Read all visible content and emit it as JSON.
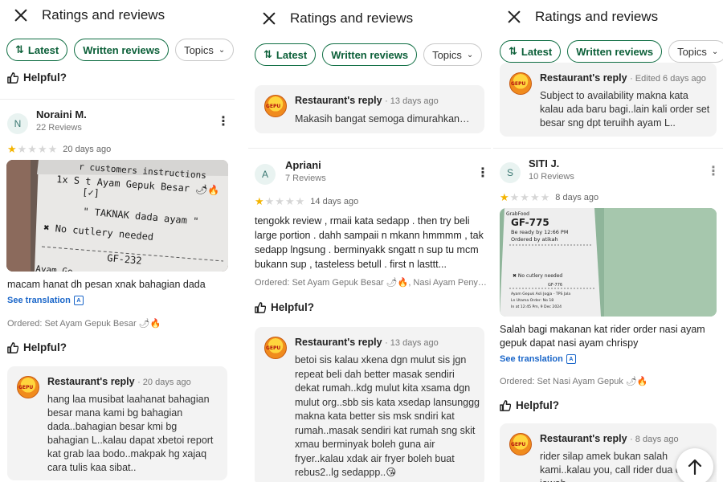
{
  "header": {
    "title": "Ratings and reviews"
  },
  "filters": {
    "latest": "Latest",
    "written": "Written reviews",
    "topics": "Topics"
  },
  "helpful_label": "Helpful?",
  "see_translation": "See translation",
  "reply_label": "Restaurant's reply",
  "panel1": {
    "reviewer": {
      "initial": "N",
      "name": "Noraini M.",
      "reviews": "22 Reviews"
    },
    "rating": 1,
    "days": "20 days ago",
    "photo_lines": [
      "r customers instructions",
      "1x  S t Ayam Gepuk Besar 🌶🔥",
      "[✓]",
      "\" TAKNAK dada ayam \"",
      "✖ No cutlery needed",
      "GF-232",
      "Ayam Ge"
    ],
    "review": "macam hanat dh pesan xnak bahagian dada",
    "ordered": "Ordered: Set Ayam Gepuk Besar 🌶🔥",
    "reply_meta": "20 days ago",
    "reply_text": "hang laa musibat laahanat bahagian besar mana kami bg bahagian dada..bahagian besar kmi bg bahagian L..kalau dapat xbetoi report kat grab laa bodo..makpak hg xajaq cara tulis kaa sibat.."
  },
  "panel2": {
    "top_reply_meta": "13 days ago",
    "top_reply_text": "Makasih bangat semoga dimurahkan…",
    "reviewer": {
      "initial": "A",
      "name": "Apriani",
      "reviews": "7 Reviews"
    },
    "rating": 1,
    "days": "14 days ago",
    "review": "tengokk review , rmaii kata sedapp . then try beli large portion . dahh sampaii n mkann hmmmm , tak sedapp lngsung . berminyakk sngatt n sup tu mcm bukann sup , tasteless betull . first n lasttt...",
    "ordered": "Ordered: Set Ayam Gepuk Besar 🌶🔥, Nasi Ayam Peny…",
    "reply_meta": "13 days ago",
    "reply_text": "betoi sis kalau xkena dgn mulut sis jgn repeat beli dah better masak sendiri dekat rumah..kdg mulut kita xsama dgn mulut org..sbb sis kata xsedap lansunggg makna kata better sis msk sndiri kat rumah..masak sendiri kat rumah sng skit xmau berminyak boleh guna air fryer..kalau xdak air fryer boleh buat rebus2..lg sedappp..😘"
  },
  "panel3": {
    "top_reply_meta": "Edited 6 days ago",
    "top_reply_text": "Subject to availability makna kata kalau ada baru bagi..lain kali order set besar sng dpt teruihh ayam L..",
    "reviewer": {
      "initial": "S",
      "name": "SITI J.",
      "reviews": "10 Reviews"
    },
    "rating": 1,
    "days": "8 days ago",
    "photo_lines": [
      "GrabFood",
      "GF-775",
      "Be ready by 12:66 PM",
      "Ordered by atikah",
      "✖ No cutlery needed",
      "GF-776",
      "Ayam Gepuk Asli Jogja - TPS Jala",
      "Ln Utama Order: No 18",
      "In at 12:45 Pm, 9 Dec 2024"
    ],
    "review": "Salah bagi makanan kat rider order nasi ayam gepuk dapat nasi ayam chrispy",
    "ordered": "Ordered: Set Nasi Ayam Gepuk 🌶🔥",
    "reply_meta": "8 days ago",
    "reply_text": "rider silap amek bukan salah kami..kalau you, call rider dua dua tak jawab.."
  },
  "colors": {
    "accent_green": "#0f6e43",
    "star": "#f4b400",
    "link_blue": "#1a66c9"
  },
  "icons": [
    "close-icon",
    "sort-icon",
    "chevron-down-icon",
    "thumbs-up-icon",
    "more-vertical-icon",
    "translate-icon",
    "restaurant-logo-icon",
    "arrow-up-icon"
  ]
}
